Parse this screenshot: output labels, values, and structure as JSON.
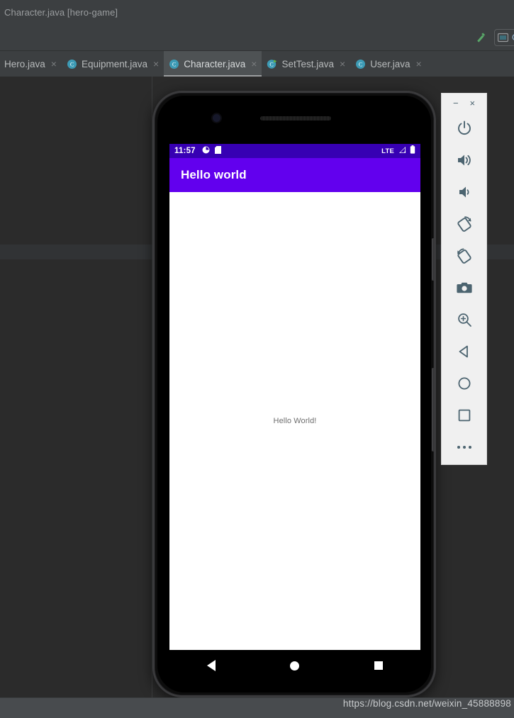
{
  "ide": {
    "title": "Character.java [hero-game]",
    "toolbar": {
      "build_icon": "hammer-icon",
      "run_config_label": "Ga",
      "run_config_icon": "android-device-icon"
    },
    "tabs": [
      {
        "label": "Hero.java",
        "icon": "java-class-icon",
        "active": false,
        "close": "×"
      },
      {
        "label": "Equipment.java",
        "icon": "java-class-icon",
        "active": false,
        "close": "×"
      },
      {
        "label": "Character.java",
        "icon": "java-class-icon",
        "active": true,
        "close": "×"
      },
      {
        "label": "SetTest.java",
        "icon": "java-test-class-icon",
        "active": false,
        "close": "×"
      },
      {
        "label": "User.java",
        "icon": "java-class-icon",
        "active": false,
        "close": "×"
      }
    ],
    "watermark": "https://blog.csdn.net/weixin_45888898",
    "colors": {
      "chrome": "#3c3f41",
      "editor_bg": "#2b2b2b",
      "tab_active_bg": "#4e5254",
      "status_bar": "#484b4e",
      "accent_green": "#59a869",
      "link_blue": "#96b8d4"
    }
  },
  "emulator": {
    "window_buttons": [
      {
        "name": "minimize",
        "glyph": "−"
      },
      {
        "name": "close",
        "glyph": "×"
      }
    ],
    "buttons": [
      {
        "name": "power-button",
        "icon": "power-icon"
      },
      {
        "name": "volume-up-button",
        "icon": "volume-up-icon"
      },
      {
        "name": "volume-down-button",
        "icon": "volume-down-icon"
      },
      {
        "name": "rotate-left-button",
        "icon": "rotate-left-icon"
      },
      {
        "name": "rotate-right-button",
        "icon": "rotate-right-icon"
      },
      {
        "name": "screenshot-button",
        "icon": "camera-icon"
      },
      {
        "name": "zoom-button",
        "icon": "magnifier-plus-icon"
      },
      {
        "name": "back-button",
        "icon": "triangle-back-icon"
      },
      {
        "name": "home-button",
        "icon": "circle-home-icon"
      },
      {
        "name": "overview-button",
        "icon": "square-overview-icon"
      },
      {
        "name": "more-button",
        "icon": "ellipsis-icon"
      }
    ],
    "toolbar_bg": "#f0f0f0",
    "icon_color": "#4c6470"
  },
  "device": {
    "status_bar": {
      "time": "11:57",
      "left_icons": [
        "alarm-icon",
        "sd-card-icon"
      ],
      "network_label": "LTE",
      "right_icons": [
        "signal-bars-icon",
        "battery-icon"
      ],
      "background": "#3700B3"
    },
    "app_bar": {
      "title": "Hello world",
      "background": "#6200EE",
      "text_color": "#ffffff"
    },
    "content": {
      "text": "Hello World!",
      "background": "#ffffff",
      "text_color": "#6e6e6e"
    },
    "nav_bar": {
      "buttons": [
        {
          "name": "nav-back-button",
          "icon": "back-triangle-icon"
        },
        {
          "name": "nav-home-button",
          "icon": "home-circle-icon"
        },
        {
          "name": "nav-recents-button",
          "icon": "recents-square-icon"
        }
      ],
      "background": "#000000"
    }
  }
}
